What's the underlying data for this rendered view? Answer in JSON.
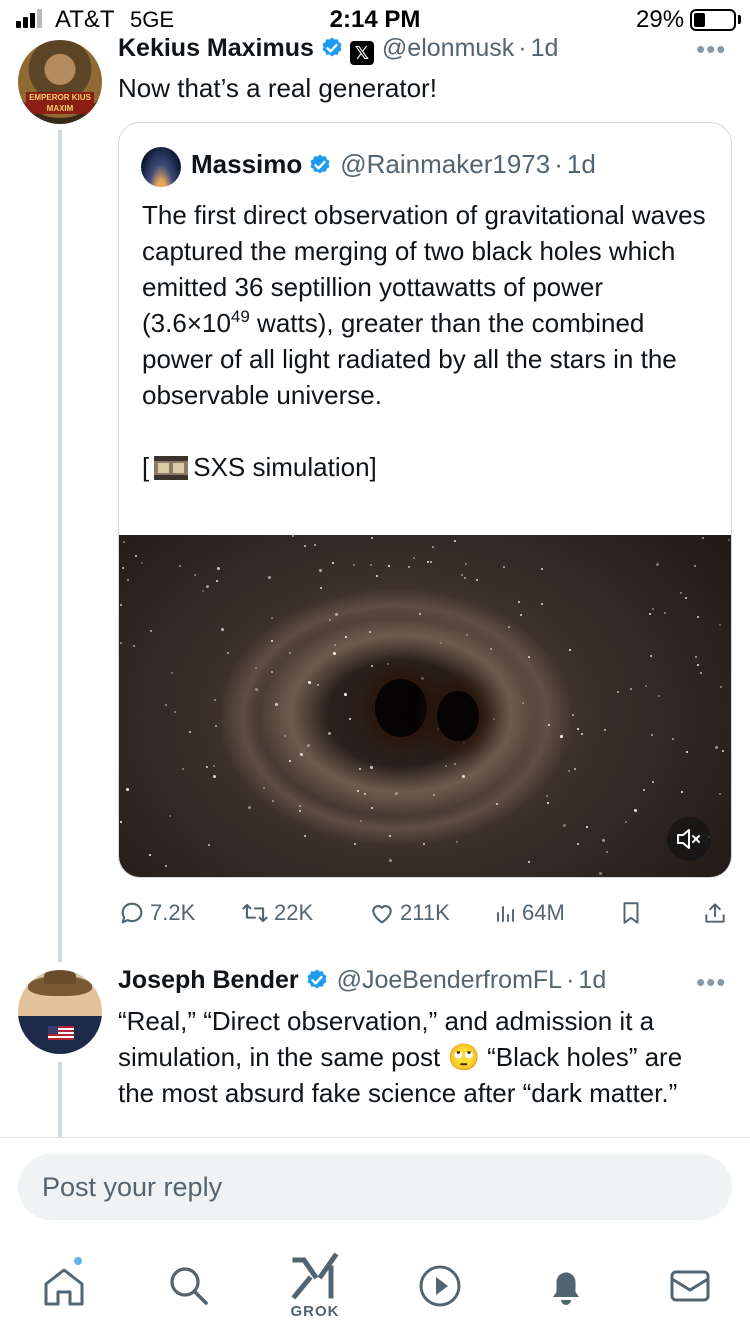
{
  "status_bar": {
    "carrier": "AT&T",
    "network": "5GE",
    "time": "2:14 PM",
    "battery": "29%",
    "battery_level": 0.29
  },
  "main_tweet": {
    "author_name": "Kekius Maximus",
    "handle": "@elonmusk",
    "time": "1d",
    "avatar_caption": "EMPEROR KIUS MAXIM",
    "text": "Now that’s a real generator!"
  },
  "quoted_tweet": {
    "author_name": "Massimo",
    "handle": "@Rainmaker1973",
    "time": "1d",
    "text_part1": "The first direct observation of gravitational waves captured the merging of two black holes which emitted 36 septillion yottawatts of power (3.6×10",
    "text_sup": "49",
    "text_part2": " watts), greater than the combined power of all light radiated by all the stars in the observable universe.",
    "link_open": "[",
    "link_text": "SXS simulation]",
    "media_label": "black hole merger video"
  },
  "actions": {
    "replies": "7.2K",
    "reposts": "22K",
    "likes": "211K",
    "views": "64M"
  },
  "reply_tweet": {
    "author_name": "Joseph Bender",
    "handle": "@JoeBenderfromFL",
    "time": "1d",
    "text": "“Real,” “Direct observation,” and admission it a simulation, in the same post 🙄 “Black holes” are the most absurd fake science after “dark matter.”"
  },
  "reply_bar": {
    "placeholder": "Post your reply"
  },
  "bottom_nav": {
    "grok_label": "GROK"
  },
  "colors": {
    "accent": "#1d9bf0",
    "text_secondary": "#536471",
    "border": "#cfd9de"
  }
}
